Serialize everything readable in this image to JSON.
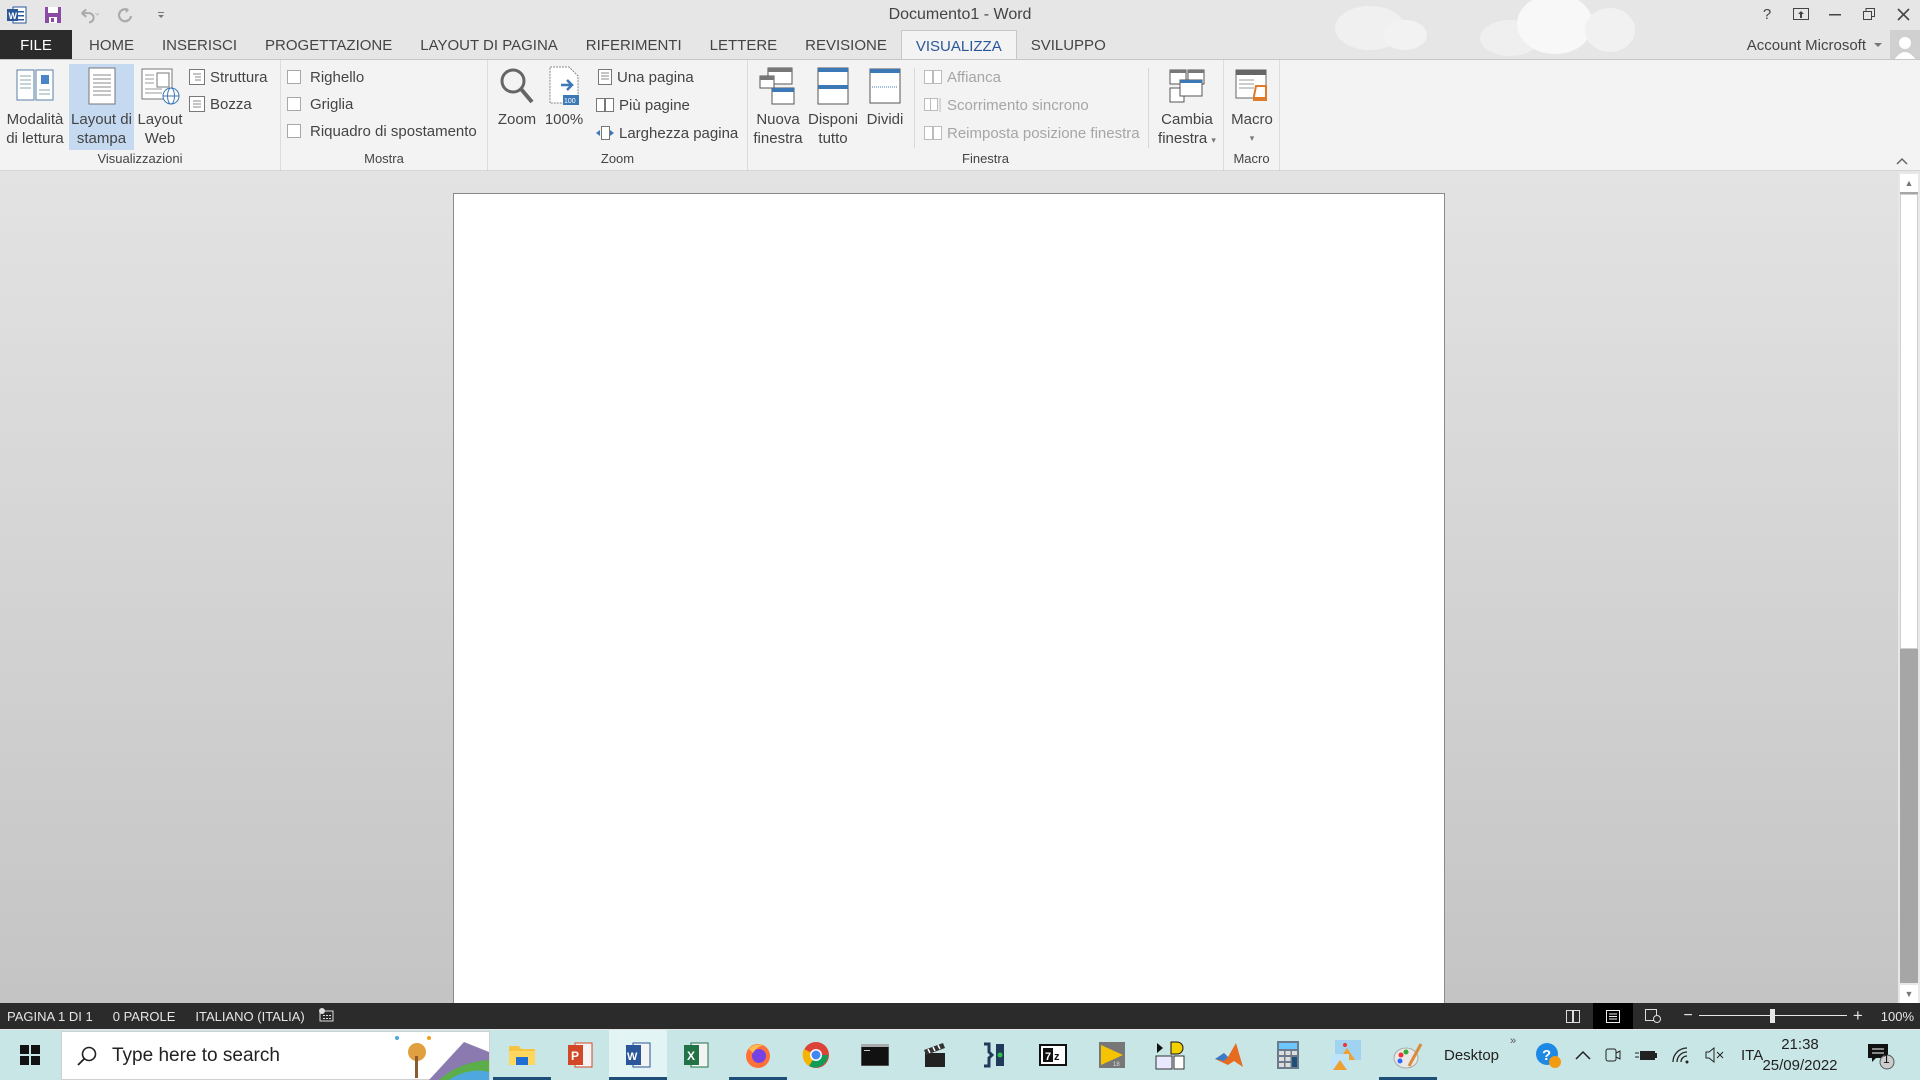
{
  "app": {
    "title": "Documento1 - Word"
  },
  "qat": {
    "icons": [
      "word-logo-icon",
      "save-icon",
      "undo-icon",
      "redo-icon",
      "customize-qat-icon"
    ]
  },
  "window_controls": {
    "help": "?",
    "ribbon_display": "ribbon-display-options-icon",
    "minimize": "minimize-icon",
    "restore": "restore-icon",
    "close": "close-icon"
  },
  "account": {
    "label": "Account Microsoft"
  },
  "tabs": [
    {
      "label": "FILE"
    },
    {
      "label": "HOME"
    },
    {
      "label": "INSERISCI"
    },
    {
      "label": "PROGETTAZIONE"
    },
    {
      "label": "LAYOUT DI PAGINA"
    },
    {
      "label": "RIFERIMENTI"
    },
    {
      "label": "LETTERE"
    },
    {
      "label": "REVISIONE"
    },
    {
      "label": "VISUALIZZA",
      "active": true
    },
    {
      "label": "SVILUPPO"
    }
  ],
  "ribbon": {
    "visualizzazioni": {
      "label": "Visualizzazioni",
      "reading_mode": {
        "line1": "Modalità",
        "line2": "di lettura"
      },
      "print_layout": {
        "line1": "Layout di",
        "line2": "stampa",
        "selected": true
      },
      "web_layout": {
        "line1": "Layout",
        "line2": "Web"
      },
      "outline": "Struttura",
      "draft": "Bozza"
    },
    "mostra": {
      "label": "Mostra",
      "ruler": {
        "label": "Righello",
        "checked": false
      },
      "gridlines": {
        "label": "Griglia",
        "checked": false
      },
      "nav_pane": {
        "label": "Riquadro di spostamento",
        "checked": false
      }
    },
    "zoom": {
      "label": "Zoom",
      "zoom": "Zoom",
      "hundred": "100%",
      "one_page": "Una pagina",
      "multi_page": "Più pagine",
      "page_width": "Larghezza pagina"
    },
    "finestra": {
      "label": "Finestra",
      "new_window": {
        "line1": "Nuova",
        "line2": "finestra"
      },
      "arrange_all": {
        "line1": "Disponi",
        "line2": "tutto"
      },
      "split": "Dividi",
      "side_by_side": "Affianca",
      "sync_scroll": "Scorrimento sincrono",
      "reset_position": "Reimposta posizione finestra",
      "switch_windows": {
        "line1": "Cambia",
        "line2": "finestra"
      }
    },
    "macro": {
      "label": "Macro",
      "button": "Macro"
    }
  },
  "statusbar": {
    "page": "PAGINA 1 DI 1",
    "words": "0 PAROLE",
    "language": "ITALIANO (ITALIA)",
    "zoom_minus": "−",
    "zoom_plus": "+",
    "zoom_level": "100%",
    "zoom_percent": 100
  },
  "taskbar": {
    "search_placeholder": "Type here to search",
    "apps": [
      "file-explorer",
      "powerpoint",
      "word",
      "excel",
      "firefox",
      "chrome",
      "terminal",
      "video-editor",
      "xcode-like-app",
      "7zip",
      "labview",
      "logic-circuit-app",
      "matlab",
      "calculator",
      "photos",
      "paint"
    ],
    "desktop_label": "Desktop",
    "language": "ITA",
    "time": "21:38",
    "date": "25/09/2022",
    "notifications_count": "1"
  },
  "colors": {
    "accent": "#2b579a",
    "file_tab": "#2b2b2b",
    "selected_button": "#c5d9f1",
    "statusbar": "#2b2b2b",
    "taskbar": "#c9e6e6"
  }
}
